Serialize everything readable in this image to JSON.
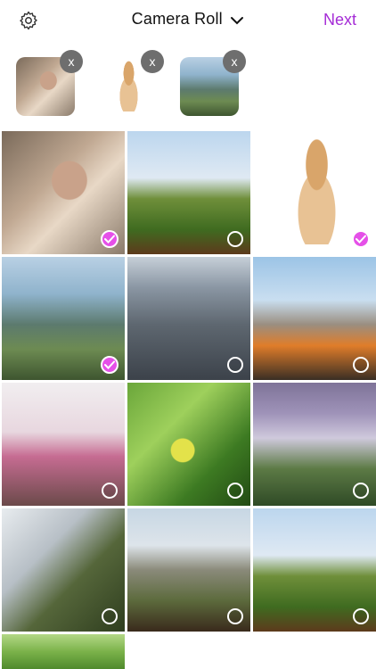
{
  "header": {
    "title": "Camera Roll",
    "next_label": "Next",
    "settings_icon": "gear-icon",
    "dropdown_icon": "chevron-down-icon"
  },
  "selected": [
    {
      "name": "portrait",
      "remove_label": "x"
    },
    {
      "name": "dog",
      "remove_label": "x"
    },
    {
      "name": "rio",
      "remove_label": "x"
    }
  ],
  "photos": [
    {
      "subject": "portrait",
      "selected": true
    },
    {
      "subject": "grass",
      "selected": false
    },
    {
      "subject": "dog",
      "selected": true
    },
    {
      "subject": "rio",
      "selected": true
    },
    {
      "subject": "city",
      "selected": false
    },
    {
      "subject": "paris",
      "selected": false
    },
    {
      "subject": "eiffel",
      "selected": false
    },
    {
      "subject": "leaves",
      "selected": false
    },
    {
      "subject": "waterfall",
      "selected": false
    },
    {
      "subject": "stream",
      "selected": false
    },
    {
      "subject": "fall2",
      "selected": false
    },
    {
      "subject": "grass",
      "selected": false
    },
    {
      "subject": "leaves2",
      "selected": false
    }
  ],
  "colors": {
    "accent": "#a52cd6",
    "check": "#e550e8",
    "remove_badge": "#6e6e6e"
  }
}
